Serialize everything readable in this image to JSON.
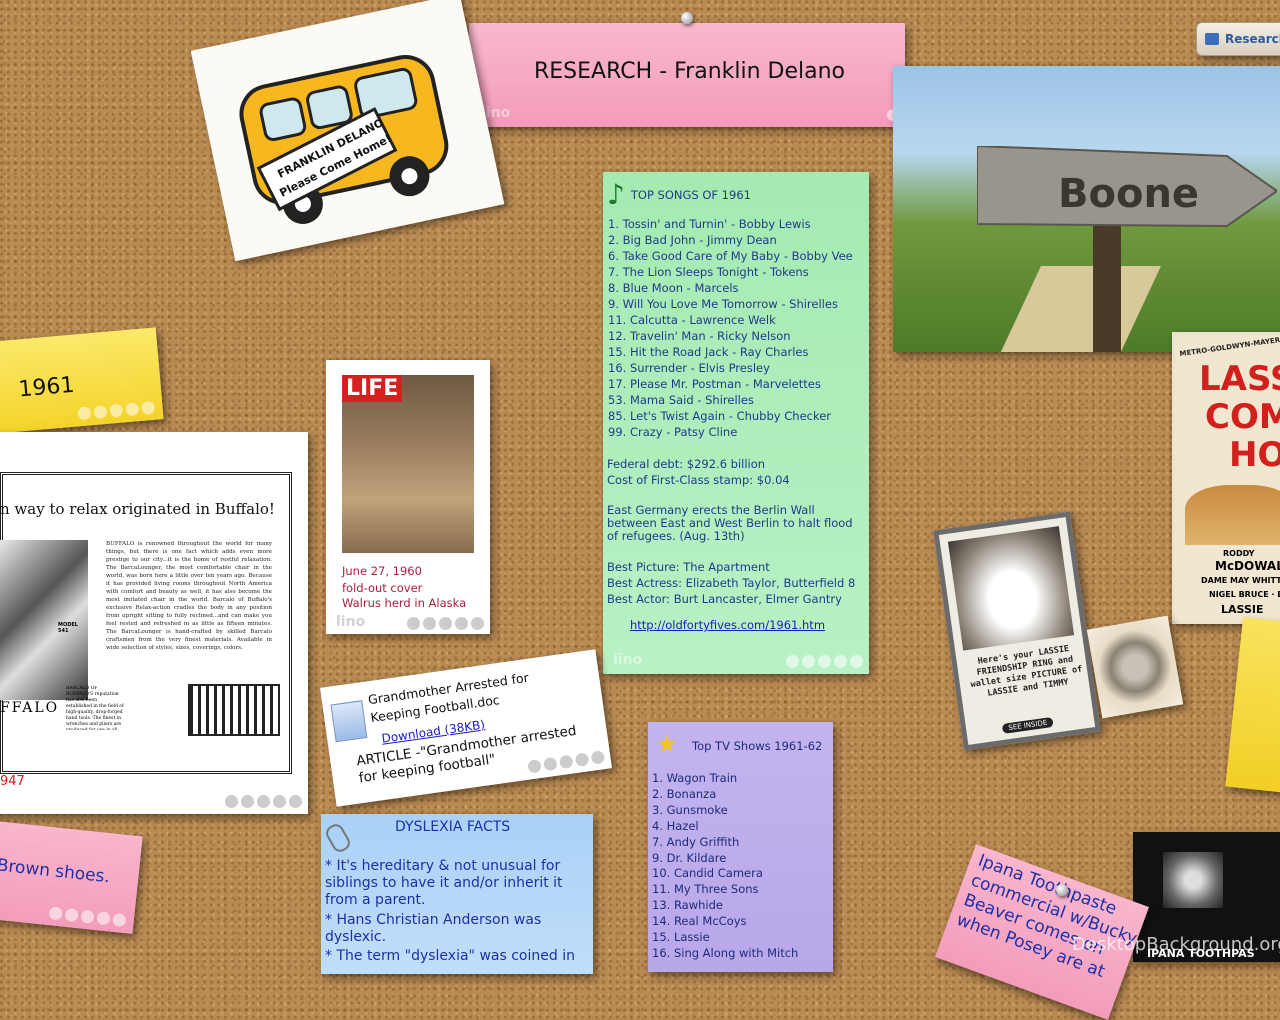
{
  "top_right_button": {
    "label": "Research"
  },
  "research_header": {
    "title": "RESEARCH - Franklin Delano"
  },
  "bus_note": {
    "line1": "FRANKLIN DELANO",
    "line2": "Please Come Home!"
  },
  "year_note": {
    "text": "1961"
  },
  "songs_note": {
    "title": "TOP SONGS OF 1961",
    "songs": [
      "1. Tossin' and Turnin' - Bobby Lewis",
      "2. Big Bad John - Jimmy Dean",
      "6. Take Good Care of My Baby - Bobby Vee",
      "7. The Lion Sleeps Tonight - Tokens",
      "8. Blue Moon - Marcels",
      "9. Will You Love Me Tomorrow - Shirelles",
      "11. Calcutta - Lawrence Welk",
      "12. Travelin' Man - Ricky Nelson",
      "15. Hit the Road Jack - Ray Charles",
      "16. Surrender - Elvis Presley",
      "17. Please Mr. Postman - Marvelettes",
      "53. Mama Said - Shirelles",
      "85. Let's Twist Again - Chubby Checker",
      "99. Crazy - Patsy Cline"
    ],
    "debt": "Federal debt: $292.6 billion",
    "stamp": "Cost of First-Class stamp: $0.04",
    "event": "East Germany erects the Berlin Wall between East and West Berlin to halt flood of refugees. (Aug. 13th)",
    "best_picture": "Best Picture: The Apartment",
    "best_actress": "Best Actress: Elizabeth Taylor, Butterfield 8",
    "best_actor": "Best Actor: Burt Lancaster, Elmer Gantry",
    "link": "http://oldfortyfives.com/1961.htm"
  },
  "boone_photo": {
    "sign_text": "Boone"
  },
  "lassie_poster": {
    "studio": "METRO-GOLDWYN-MAYER'S TECH",
    "title_lines": [
      "LASS",
      "COM",
      "HO"
    ],
    "cast": [
      "RODDY",
      "McDOWALL",
      "DAME MAY WHITTY · ELS",
      "NIGEL BRUCE · ELS",
      "LASSIE"
    ]
  },
  "lassie_ring": {
    "caption": "Here's your LASSIE FRIENDSHIP RING and wallet size PICTURE of LASSIE and TIMMY",
    "see_inside": "SEE INSIDE"
  },
  "life_note": {
    "masthead": "LIFE",
    "date": "June 27, 1960",
    "desc1": "fold-out cover",
    "desc2": "Walrus herd in Alaska"
  },
  "ad_note": {
    "headline": "n way to relax originated in Buffalo!",
    "body": "BUFFALO is renowned throughout the world for many things, but there is one fact which adds even more prestige to our city...it is the home of restful relaxation. The BarcaLounger, the most comfortable chair in the world, was born here a little over ten years ago. Because it has provided living rooms throughout North America with comfort and beauty as well, it has also become the most imitated chair in the world. Barcalo of Buffalo's exclusive Relax-action cradles the body in any position from upright sitting to fully reclined...and can make you feel rested and refreshed in as little as fifteen minutes. The BarcaLounger is hand-crafted by skilled Barcalo craftsmen from the very finest materials. Available in wide selection of styles, sizes, coverings, colors.",
    "model": "MODEL 541",
    "city": "FFALO",
    "footer": "BARCALO OF BUFFALO'S reputation has also been established in the field of high-quality, drop-forged hand tools. The finest in wrenches and pliers are produced for use in all parts of the world.",
    "year": "947"
  },
  "grandmother_note": {
    "filename": "Grandmother Arrested for Keeping Football.doc",
    "download": "Download (38KB)",
    "article": "ARTICLE -\"Grandmother arrested for keeping football\""
  },
  "dyslexia_note": {
    "title": "DYSLEXIA FACTS",
    "facts": [
      "* It's hereditary & not unusual for siblings to have it and/or inherit it from a parent.",
      "* Hans Christian Anderson was dyslexic.",
      "* The term \"dyslexia\" was coined in"
    ]
  },
  "tv_note": {
    "title": "Top TV Shows 1961-62",
    "shows": [
      "1. Wagon Train",
      "2. Bonanza",
      "3. Gunsmoke",
      "4. Hazel",
      "7. Andy Griffith",
      "9. Dr. Kildare",
      "10. Candid Camera",
      "11. My Three Sons",
      "13. Rawhide",
      "14. Real McCoys",
      "15. Lassie",
      "16. Sing Along with Mitch"
    ]
  },
  "brown_shoes_note": {
    "text": "Brown shoes."
  },
  "ipana_note": {
    "text": "Ipana Toothpaste commercial w/Bucky Beaver comes on when Posey are at"
  },
  "ipana_video": {
    "caption": "IPANA TOOTHPAS"
  },
  "watermark": {
    "text": "DesktopBackground.org"
  },
  "colors": {
    "pink": "#f5a9c4",
    "green": "#a6ecb0",
    "yellow": "#f7e14a",
    "blue": "#b2d6f7",
    "purple": "#c6b7ee",
    "link": "#1a1ac8",
    "note_text": "#1e3a8a"
  }
}
